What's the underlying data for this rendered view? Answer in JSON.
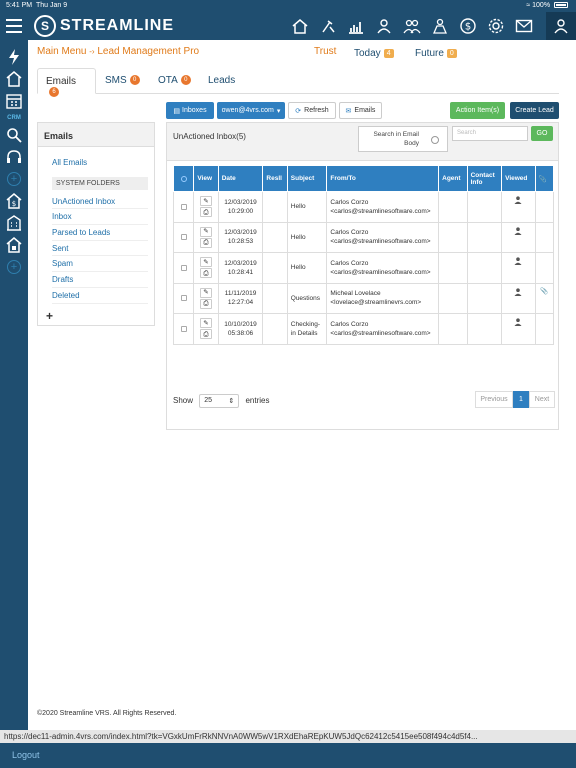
{
  "status": {
    "time": "5:41 PM",
    "date": "Thu Jan 9",
    "battery": "100%"
  },
  "app": {
    "logo_letter": "S",
    "logo_text": "STREAMLINE"
  },
  "header": {
    "breadcrumb_main": "Main Menu",
    "breadcrumb_sep": "-›",
    "breadcrumb_current": "Lead Management Pro",
    "trust": "Trust",
    "today": "Today",
    "today_count": "4",
    "future": "Future",
    "future_count": "0"
  },
  "tabs": [
    {
      "label": "Emails",
      "count": "6"
    },
    {
      "label": "SMS",
      "count": "0"
    },
    {
      "label": "OTA",
      "count": "0"
    },
    {
      "label": "Leads"
    }
  ],
  "toolbar": {
    "inboxes": "Inboxes",
    "account": "owen@4vrs.com",
    "refresh": "Refresh",
    "emails": "Emails",
    "action_items": "Action Item(s)",
    "create_lead": "Create Lead"
  },
  "folders": {
    "title": "Emails",
    "all": "All Emails",
    "system_label": "SYSTEM FOLDERS",
    "items": [
      "UnActioned Inbox",
      "Inbox",
      "Parsed to Leads",
      "Sent",
      "Spam",
      "Drafts",
      "Deleted"
    ],
    "add": "+"
  },
  "inbox": {
    "title": "UnActioned Inbox(5)",
    "search_body_label_1": "Search in Email",
    "search_body_label_2": "Body",
    "search_placeholder": "Search",
    "go": "GO"
  },
  "table": {
    "columns": [
      "View",
      "Date",
      "Resll",
      "Subject",
      "From/To",
      "Agent",
      "Contact Info",
      "Viewed"
    ],
    "rows": [
      {
        "date1": "12/03/2019",
        "date2": "10:29:00",
        "subject": "Hello",
        "from_name": "Carlos Corzo",
        "from_email": "<carlos@streamlinesoftware.com>",
        "attach": false
      },
      {
        "date1": "12/03/2019",
        "date2": "10:28:53",
        "subject": "Hello",
        "from_name": "Carlos Corzo",
        "from_email": "<carlos@streamlinesoftware.com>",
        "attach": false
      },
      {
        "date1": "12/03/2019",
        "date2": "10:28:41",
        "subject": "Hello",
        "from_name": "Carlos Corzo",
        "from_email": "<carlos@streamlinesoftware.com>",
        "attach": false
      },
      {
        "date1": "11/11/2019",
        "date2": "12:27:04",
        "subject": "Questions",
        "from_name": "Micheal Lovelace",
        "from_email": "<lovelace@streamlinevrs.com>",
        "attach": true
      },
      {
        "date1": "10/10/2019",
        "date2": "05:38:06",
        "subject": "Checking-in Details",
        "from_name": "Carlos Corzo",
        "from_email": "<carlos@streamlinesoftware.com>",
        "attach": false
      }
    ]
  },
  "pager": {
    "show": "Show",
    "entries_value": "25",
    "entries": "entries",
    "previous": "Previous",
    "page": "1",
    "next": "Next"
  },
  "footer": {
    "copyright": "©2020 Streamline VRS. All Rights Reserved."
  },
  "url": "https://dec11-admin.4vrs.com/index.html?tk=VGxkUmFrRkNNVnA0WW5wV1RXdEhaREpKUW5JdQc62412c5415ee508f494c4d5f4...",
  "logout": "Logout",
  "colors": {
    "nav": "#1f4e70",
    "accent_orange": "#e07b1a",
    "table_header": "#2f7fc0",
    "go_green": "#5cb85c"
  }
}
